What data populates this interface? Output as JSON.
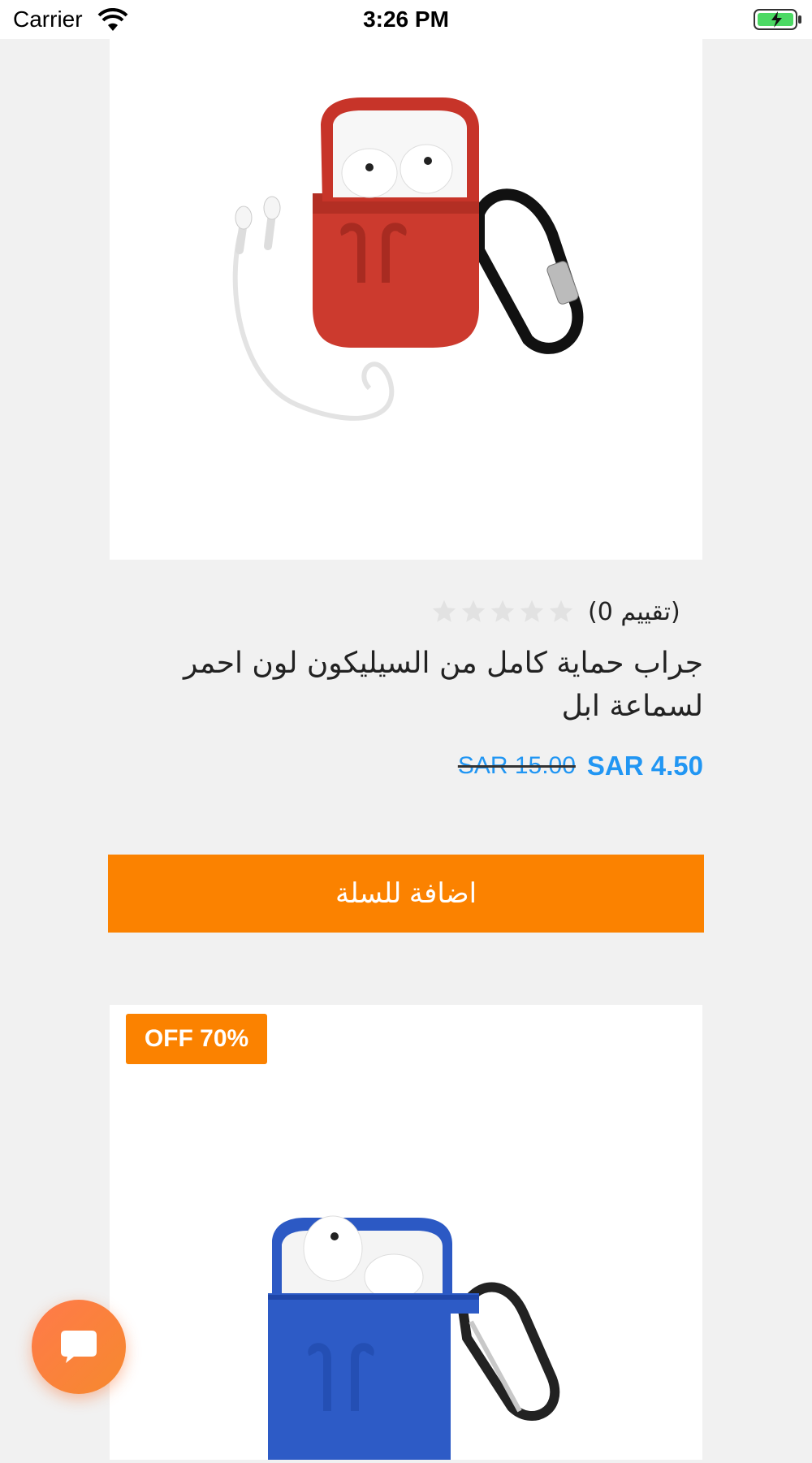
{
  "status_bar": {
    "carrier": "Carrier",
    "time": "3:26 PM",
    "icons": [
      "wifi-icon",
      "battery-charging-icon"
    ]
  },
  "products": [
    {
      "image": "red-airpods-silicone-case-image",
      "rating_text": "(تقييم 0)",
      "stars": 0,
      "title": "جراب حماية كامل من السيليكون لون احمر لسماعة ابل",
      "old_price": "SAR 15.00",
      "new_price": "SAR 4.50",
      "add_to_cart_label": "اضافة للسلة"
    },
    {
      "image": "blue-airpods-silicone-case-image",
      "discount_badge": "OFF 70%"
    }
  ],
  "colors": {
    "accent": "#fb8200",
    "price": "#2196f3",
    "background": "#f1f1f1"
  },
  "chat_button_icon": "chat-bubble-icon"
}
